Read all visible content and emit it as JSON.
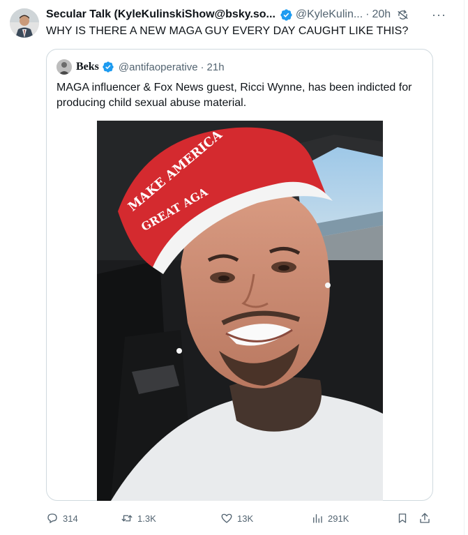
{
  "tweet": {
    "display_name": "Secular Talk (KyleKulinskiShow@bsky.so...",
    "handle": "@KyleKulin...",
    "separator": "·",
    "time": "20h",
    "more": "···",
    "text": "WHY IS THERE A NEW MAGA GUY EVERY DAY CAUGHT LIKE THIS?"
  },
  "quoted": {
    "display_name": "Beks",
    "handle": "@antifaoperative",
    "separator": "·",
    "time": "21h",
    "text": "MAGA influencer & Fox News guest, Ricci Wynne, has been indicted for producing child sexual abuse material.",
    "media_hat_text": [
      "MAKE AMERICA",
      "GREAT AGA"
    ]
  },
  "actions": {
    "replies": "314",
    "retweets": "1.3K",
    "likes": "13K",
    "views": "291K"
  },
  "icons": {
    "verified": "verified-badge-icon",
    "sync": "sync-icon",
    "reply": "reply-icon",
    "retweet": "retweet-icon",
    "like": "heart-icon",
    "views": "views-chart-icon",
    "bookmark": "bookmark-icon",
    "share": "share-icon"
  },
  "colors": {
    "verified_blue": "#1d9bf0",
    "text_primary": "#0f1419",
    "text_secondary": "#536471",
    "border": "#cfd9de"
  }
}
